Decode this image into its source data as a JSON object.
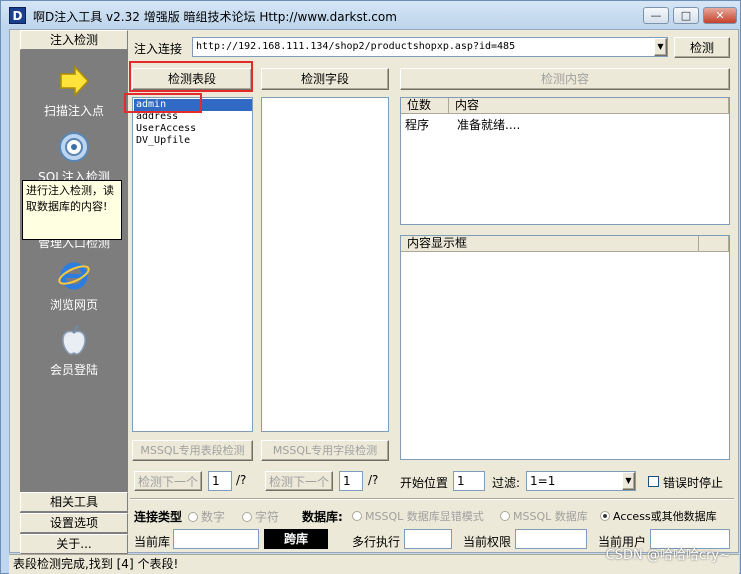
{
  "window": {
    "title": "啊D注入工具 v2.32 增强版 暗组技术论坛 Http://www.darkst.com",
    "app_icon_letter": "D",
    "min": "—",
    "max": "□",
    "close": "✕"
  },
  "sidebar": {
    "tab_top": "注入检测",
    "items": [
      {
        "label": "扫描注入点",
        "icon": "arrow-icon"
      },
      {
        "label": "SQL注入检测",
        "icon": "target-icon"
      },
      {
        "label": "管理入口检测",
        "icon": "folder-icon"
      },
      {
        "label": "浏览网页",
        "icon": "ie-icon"
      },
      {
        "label": "会员登陆",
        "icon": "apple-icon"
      }
    ],
    "tooltip": "进行注入检测，读取数据库的内容!",
    "tabs_bottom": [
      "相关工具",
      "设置选项",
      "关于..."
    ]
  },
  "toolbar": {
    "url_label": "注入连接",
    "url_value": "http://192.168.111.134/shop2/productshopxp.asp?id=485",
    "detect_button": "检测"
  },
  "columns": {
    "tables_button": "检测表段",
    "fields_button": "检测字段",
    "content_button": "检测内容"
  },
  "tables_list": [
    "admin",
    "address",
    "UserAccess",
    "DV_Upfile"
  ],
  "result_table": {
    "headers": [
      "位数",
      "内容"
    ],
    "rows": [
      [
        "程序",
        "准备就绪...."
      ]
    ]
  },
  "content_display": {
    "header": "内容显示框"
  },
  "mssql": {
    "tables_button": "MSSQL专用表段检测",
    "fields_button": "MSSQL专用字段检测"
  },
  "nav_row": {
    "next1": "检测下一个",
    "page1": "1",
    "total1": "/?",
    "next2": "检测下一个",
    "page2": "1",
    "total2": "/?",
    "start_label": "开始位置",
    "start_value": "1",
    "filter_label": "过滤:",
    "filter_value": "1=1",
    "stop_on_error": "错误时停止"
  },
  "conn": {
    "type_label": "连接类型",
    "type_options": [
      "数字",
      "字符"
    ],
    "db_label": "数据库:",
    "db_options": [
      "MSSQL 数据库显错模式",
      "MSSQL 数据库",
      "Access或其他数据库"
    ],
    "db_selected": 2
  },
  "bottom": {
    "current_db_label": "当前库",
    "fast_button": "跨库",
    "multi_exec_label": "多行执行",
    "current_perm_label": "当前权限",
    "current_user_label": "当前用户"
  },
  "status": "表段检测完成,找到 [4] 个表段!",
  "watermark": "CSDN @哈哈哈cry~"
}
